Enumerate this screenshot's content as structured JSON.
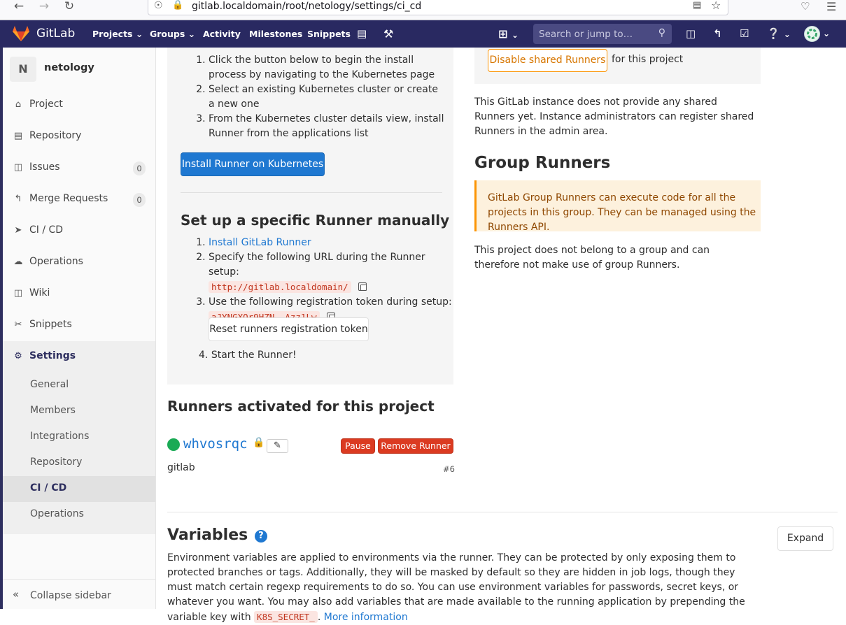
{
  "browser": {
    "url": "gitlab.localdomain/root/netology/settings/ci_cd"
  },
  "topnav": {
    "logo": "GitLab",
    "projects": "Projects",
    "groups": "Groups",
    "activity": "Activity",
    "milestones": "Milestones",
    "snippets": "Snippets",
    "search_placeholder": "Search or jump to…"
  },
  "sidebar": {
    "project_initial": "N",
    "project_name": "netology",
    "items": [
      {
        "label": "Project",
        "icon": "home-icon"
      },
      {
        "label": "Repository",
        "icon": "doc-icon"
      },
      {
        "label": "Issues",
        "icon": "issues-icon",
        "badge": "0"
      },
      {
        "label": "Merge Requests",
        "icon": "merge-icon",
        "badge": "0"
      },
      {
        "label": "CI / CD",
        "icon": "rocket-icon"
      },
      {
        "label": "Operations",
        "icon": "cloud-gear-icon"
      },
      {
        "label": "Wiki",
        "icon": "book-icon"
      },
      {
        "label": "Snippets",
        "icon": "scissors-icon"
      },
      {
        "label": "Settings",
        "icon": "gear-icon"
      }
    ],
    "settings_sub": [
      "General",
      "Members",
      "Integrations",
      "Repository",
      "CI / CD",
      "Operations"
    ],
    "collapse": "Collapse sidebar"
  },
  "k8s": {
    "step1": "Click the button below to begin the install process by navigating to the Kubernetes page",
    "step2": "Select an existing Kubernetes cluster or create a new one",
    "step3": "From the Kubernetes cluster details view, install Runner from the applications list",
    "install_button": "Install Runner on Kubernetes"
  },
  "manual": {
    "title": "Set up a specific Runner manually",
    "step1_link": "Install GitLab Runner",
    "step2": "Specify the following URL during the Runner setup:",
    "url": "http://gitlab.localdomain/",
    "step3": "Use the following registration token during setup:",
    "token": "aJYNGXQr9HZN__Azz1Lw",
    "reset_button": "Reset runners registration token",
    "step4": "Start the Runner!"
  },
  "activated": {
    "title": "Runners activated for this project",
    "runner_name": "whvosrqc",
    "pause": "Pause",
    "remove": "Remove Runner",
    "tag": "gitlab",
    "runner_id": "#6"
  },
  "shared": {
    "disable_button": "Disable shared Runners",
    "for_project": "for this project",
    "info": "This GitLab instance does not provide any shared Runners yet. Instance administrators can register shared Runners in the admin area."
  },
  "group": {
    "title": "Group Runners",
    "alert": "GitLab Group Runners can execute code for all the projects in this group. They can be managed using the Runners API.",
    "info": "This project does not belong to a group and can therefore not make use of group Runners."
  },
  "variables": {
    "title": "Variables",
    "expand": "Expand",
    "desc": "Environment variables are applied to environments via the runner. They can be protected by only exposing them to protected branches or tags. Additionally, they will be masked by default so they are hidden in job logs, though they must match certain regexp requirements to do so. You can use environment variables for passwords, secret keys, or whatever you want. You may also add variables that are made available to the running application by prepending the variable key with",
    "prefix": "K8S_SECRET_",
    "more": "More information"
  },
  "colors": {
    "navbar": "#292961",
    "primary": "#1f78d1",
    "danger": "#db3b21",
    "warning": "#fc9403",
    "online": "#1aaa55"
  }
}
